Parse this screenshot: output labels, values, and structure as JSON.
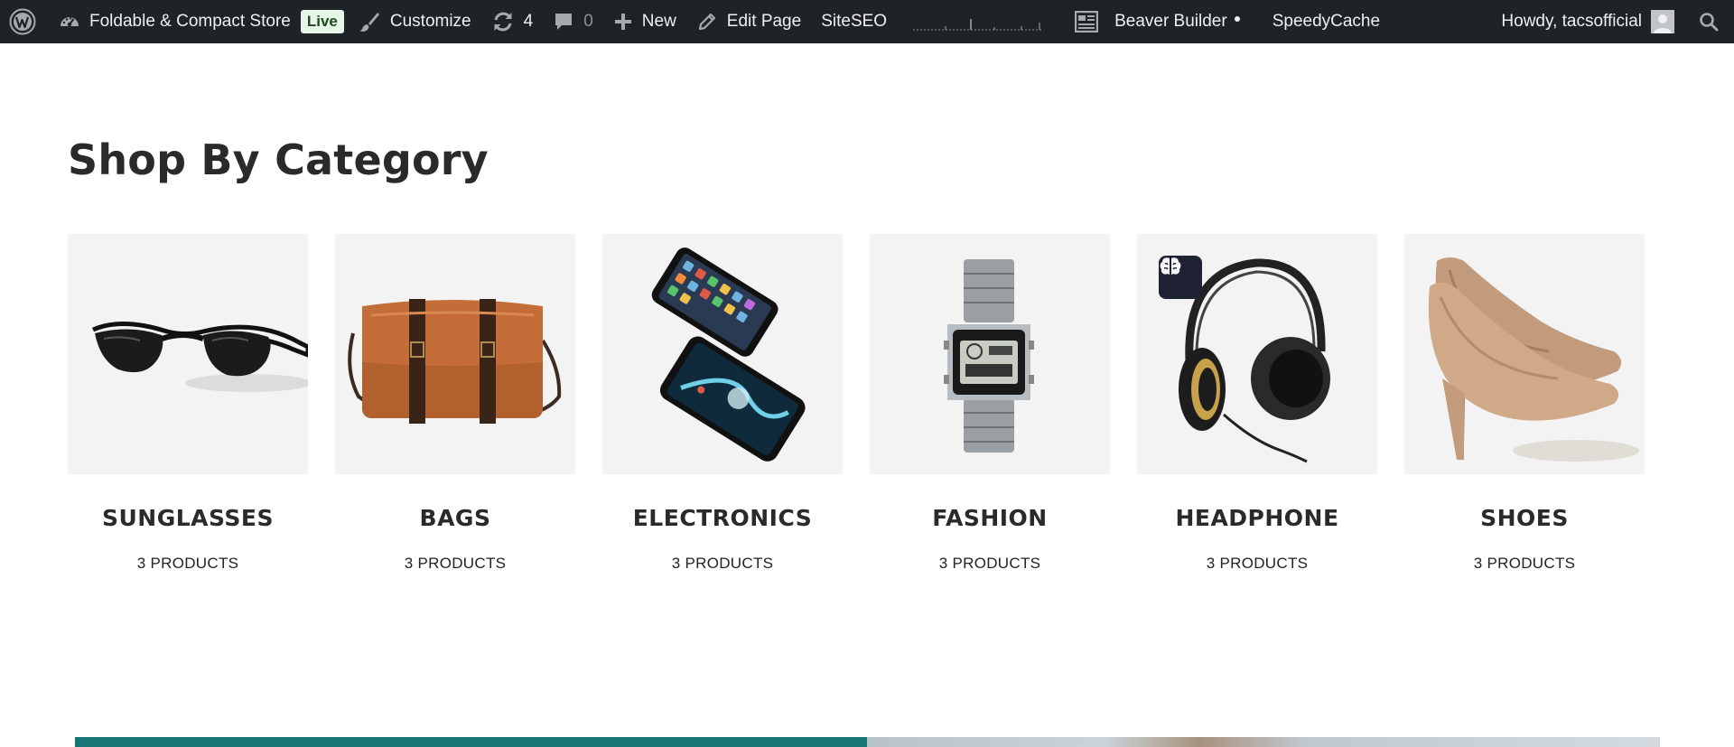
{
  "adminbar": {
    "site_name": "Foldable & Compact Store",
    "live_label": "Live",
    "customize_label": "Customize",
    "updates_count": "4",
    "comments_count": "0",
    "new_label": "New",
    "edit_page_label": "Edit Page",
    "siteseo_label": "SiteSEO",
    "beaver_builder_label": "Beaver Builder",
    "speedycache_label": "SpeedyCache",
    "howdy_label": "Howdy, tacsofficial"
  },
  "section": {
    "title": "Shop By Category"
  },
  "categories": [
    {
      "name": "SUNGLASSES",
      "count": "3 PRODUCTS"
    },
    {
      "name": "BAGS",
      "count": "3 PRODUCTS"
    },
    {
      "name": "ELECTRONICS",
      "count": "3 PRODUCTS"
    },
    {
      "name": "FASHION",
      "count": "3 PRODUCTS"
    },
    {
      "name": "HEADPHONE",
      "count": "3 PRODUCTS"
    },
    {
      "name": "SHOES",
      "count": "3 PRODUCTS"
    }
  ],
  "icons": {
    "wordpress": "wordpress-logo-icon",
    "dashboard": "dashboard-icon",
    "customize": "paintbrush-icon",
    "updates": "refresh-icon",
    "comments": "comment-icon",
    "new": "plus-icon",
    "edit": "pencil-icon",
    "beaver": "page-builder-icon",
    "avatar": "avatar-icon",
    "search": "search-icon",
    "ai": "brain-icon"
  },
  "colors": {
    "adminbar_bg": "#1d2327",
    "live_badge_bg": "#e7f5e9",
    "card_bg": "#f3f3f3",
    "banner_teal": "#167673",
    "ai_badge_bg": "#1f2233"
  }
}
